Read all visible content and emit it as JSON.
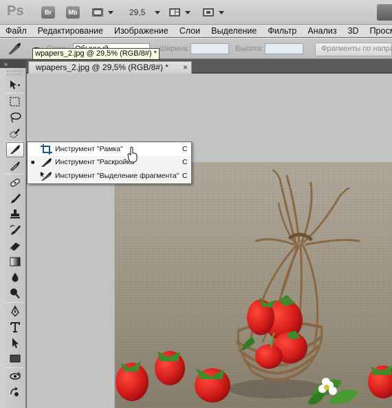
{
  "appbar": {
    "logo": "Ps",
    "bridge_badge": "Br",
    "minibridge_badge": "Mb",
    "zoom": "29,5"
  },
  "menu": [
    "Файл",
    "Редактирование",
    "Изображение",
    "Слои",
    "Выделение",
    "Фильтр",
    "Анализ",
    "3D",
    "Просмо"
  ],
  "options": {
    "style_label": "Стиль:",
    "style_value": "Обычный",
    "width_label": "Ширина:",
    "height_label": "Высота:",
    "slices_button": "Фрагменты по направ"
  },
  "tooltip": "wpapers_2.jpg @ 29,5% (RGB/8#) *",
  "collapse_glyph": "»",
  "document_tab": {
    "title": "wpapers_2.jpg @ 29,5% (RGB/8#) *",
    "close": "×"
  },
  "flyout": {
    "items": [
      {
        "label": "Инструмент \"Рамка\"",
        "shortcut": "C",
        "icon": "crop-icon",
        "selected": false,
        "hover": true
      },
      {
        "label": "Инструмент \"Раскройка\"",
        "shortcut": "C",
        "icon": "slice-icon",
        "selected": true,
        "hover": false
      },
      {
        "label": "Инструмент \"Выделение фрагмента\"",
        "shortcut": "C",
        "icon": "slice-select-icon",
        "selected": false,
        "hover": false
      }
    ],
    "selected_marker": "■"
  },
  "tools": [
    "move-tool",
    "marquee-tool",
    "lasso-tool",
    "quick-selection-tool",
    "slice-tool",
    "eyedropper-tool",
    "healing-brush-tool",
    "brush-tool",
    "clone-stamp-tool",
    "history-brush-tool",
    "eraser-tool",
    "gradient-tool",
    "blur-tool",
    "dodge-tool",
    "pen-tool",
    "type-tool",
    "path-selection-tool",
    "rectangle-tool",
    "3d-rotate-tool",
    "3d-orbit-tool"
  ],
  "colors": {
    "canvas_bg": "#c3c3c3",
    "linen": "#9a8e7c",
    "strawberry": "#d41d1b",
    "leaf": "#3f8a2c",
    "twig": "#8a6844"
  }
}
